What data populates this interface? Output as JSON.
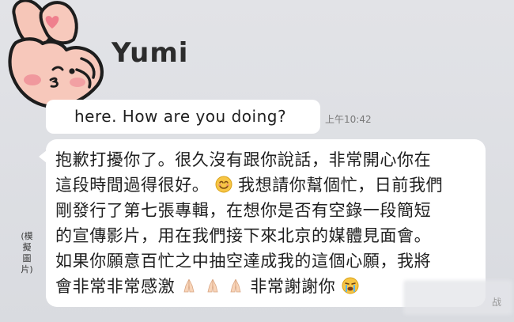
{
  "chat": {
    "sender_name": "Yumi",
    "messages": [
      {
        "text": "here. How are you doing?",
        "time": "上午10:42"
      },
      {
        "lines": [
          "抱歉打擾你了。很久沒有跟你說話，非常開心你在",
          "這段時間過得很好。",
          "我想請你幫個忙，日前我們",
          "剛發行了第七張專輯，在想你是否有空錄一段簡短",
          "的宣傳影片，用在我們接下來北京的媒體見面會。",
          "如果你願意百忙之中抽空達成我的這個心願，我將",
          "會非常非常感激",
          "非常謝謝你"
        ]
      }
    ]
  },
  "side_caption": "(模擬圖片)",
  "watermark_char": "战",
  "icons": {
    "avatar": "hand-heart-sticker-icon",
    "smile_emoji": "smiling-face-emoji-icon",
    "pray_emoji": "folded-hands-emoji-icon",
    "cry_emoji": "crying-face-emoji-icon"
  },
  "colors": {
    "background": "#d9dbe0",
    "bubble": "#ffffff",
    "text": "#1f1f1f",
    "timestamp": "#787878",
    "avatar_hand": "#f6c6b8",
    "avatar_cheek": "#ef8f98"
  }
}
